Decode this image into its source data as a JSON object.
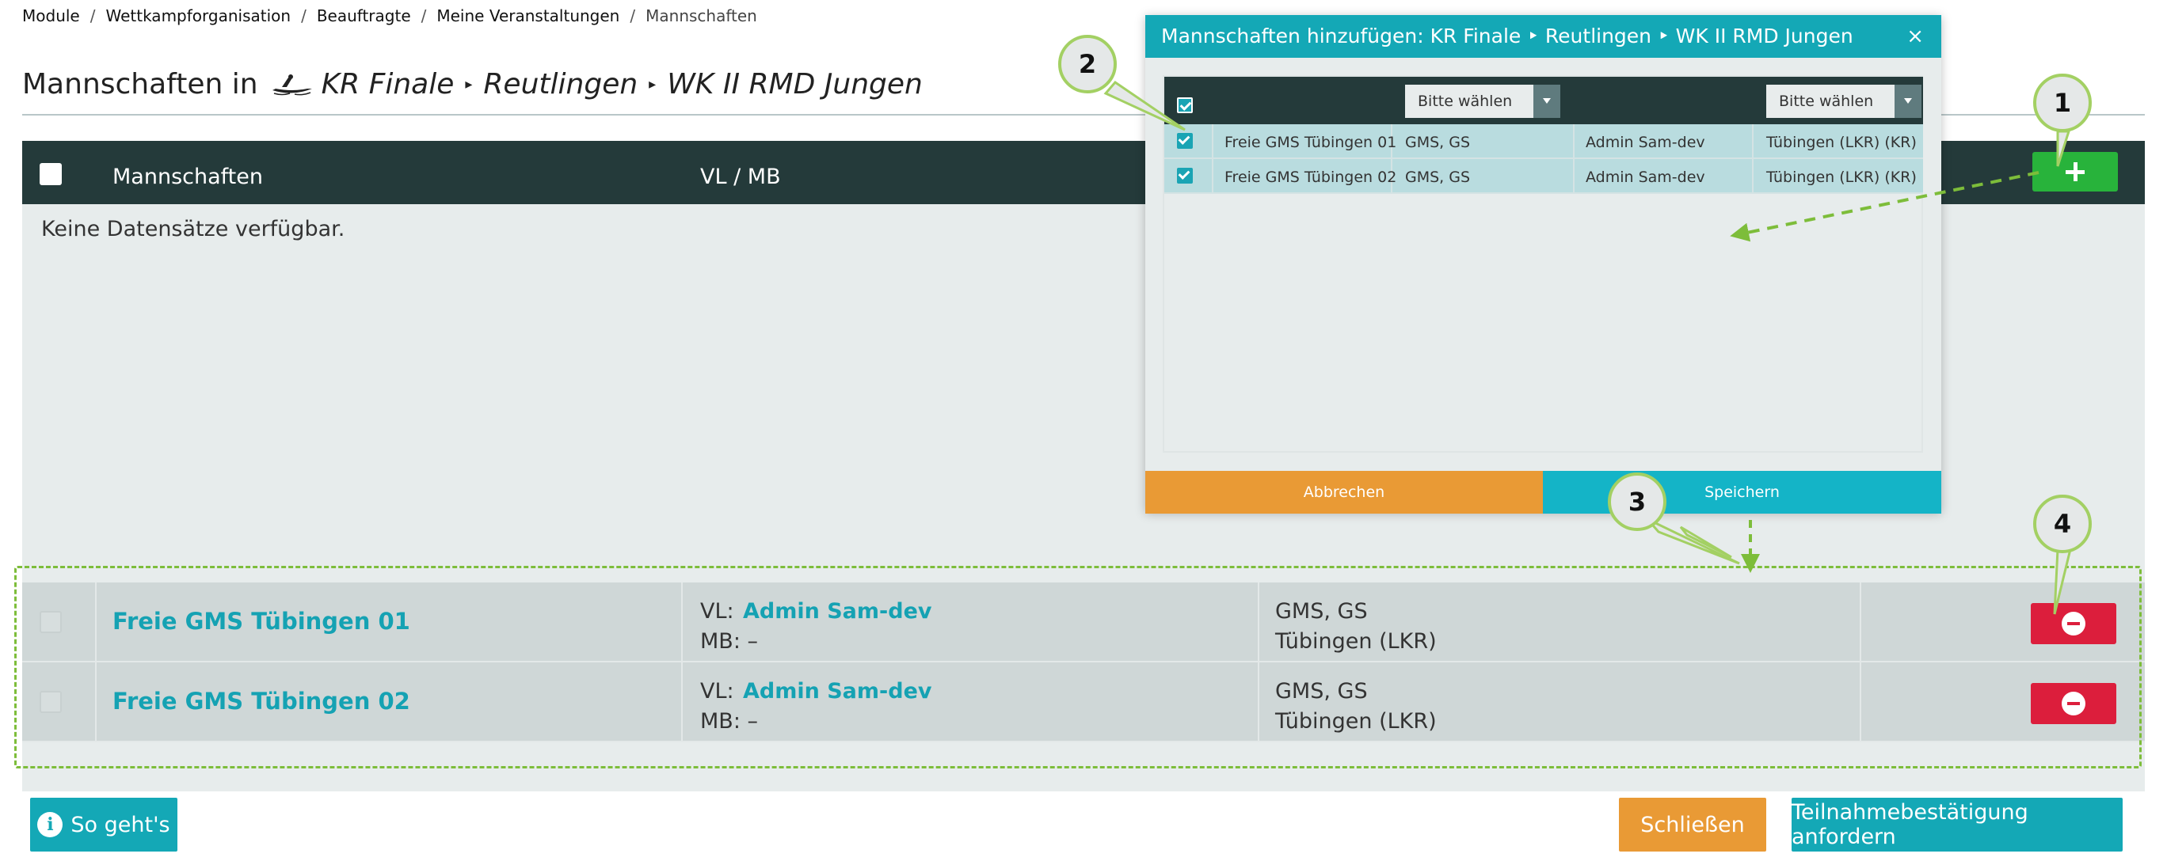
{
  "breadcrumb": {
    "items": [
      "Module",
      "Wettkampforganisation",
      "Beauftragte",
      "Meine Veranstaltungen"
    ],
    "current": "Mannschaften",
    "separator": "/"
  },
  "title": {
    "prefix": "Mannschaften in",
    "event": "KR Finale",
    "location": "Reutlingen",
    "class": "WK II RMD Jungen",
    "arrow": "▸"
  },
  "table": {
    "col_teams": "Mannschaften",
    "col_vl_mb": "VL / MB",
    "empty": "Keine Datensätze verfügbar.",
    "rows": [
      {
        "team": "Freie GMS Tübingen 01",
        "vl_label": "VL:",
        "vl": "Admin Sam-dev",
        "mb_label": "MB:",
        "mb": "–",
        "school_type": "GMS, GS",
        "district": "Tübingen (LKR)"
      },
      {
        "team": "Freie GMS Tübingen 02",
        "vl_label": "VL:",
        "vl": "Admin Sam-dev",
        "mb_label": "MB:",
        "mb": "–",
        "school_type": "GMS, GS",
        "district": "Tübingen (LKR)"
      }
    ]
  },
  "buttons": {
    "help": "So geht's",
    "close": "Schließen",
    "confirm": "Teilnahmebestätigung anfordern"
  },
  "modal": {
    "title": "Mannschaften hinzufügen: KR Finale ‣ Reutlingen ‣ WK II RMD Jungen",
    "close_symbol": "×",
    "filter1": "Bitte wählen",
    "filter2": "Bitte wählen",
    "rows": [
      {
        "team": "Freie GMS Tübingen 01",
        "type": "GMS, GS",
        "leader": "Admin Sam-dev",
        "district": "Tübingen (LKR) (KR)"
      },
      {
        "team": "Freie GMS Tübingen 02",
        "type": "GMS, GS",
        "leader": "Admin Sam-dev",
        "district": "Tübingen (LKR) (KR)"
      }
    ],
    "cancel": "Abbrechen",
    "save": "Speichern"
  },
  "callouts": [
    "1",
    "2",
    "3",
    "4"
  ],
  "colors": {
    "teal": "#14a8b6",
    "dark_header": "#243a3a",
    "green_add": "#28b33b",
    "red_remove": "#dc1e3c",
    "orange": "#e99a35",
    "annotation_green": "#7dbd3a"
  },
  "icons": {
    "add": "plus-icon",
    "remove": "minus-circle-icon",
    "help": "info-icon",
    "event": "rowing-boat-icon"
  }
}
